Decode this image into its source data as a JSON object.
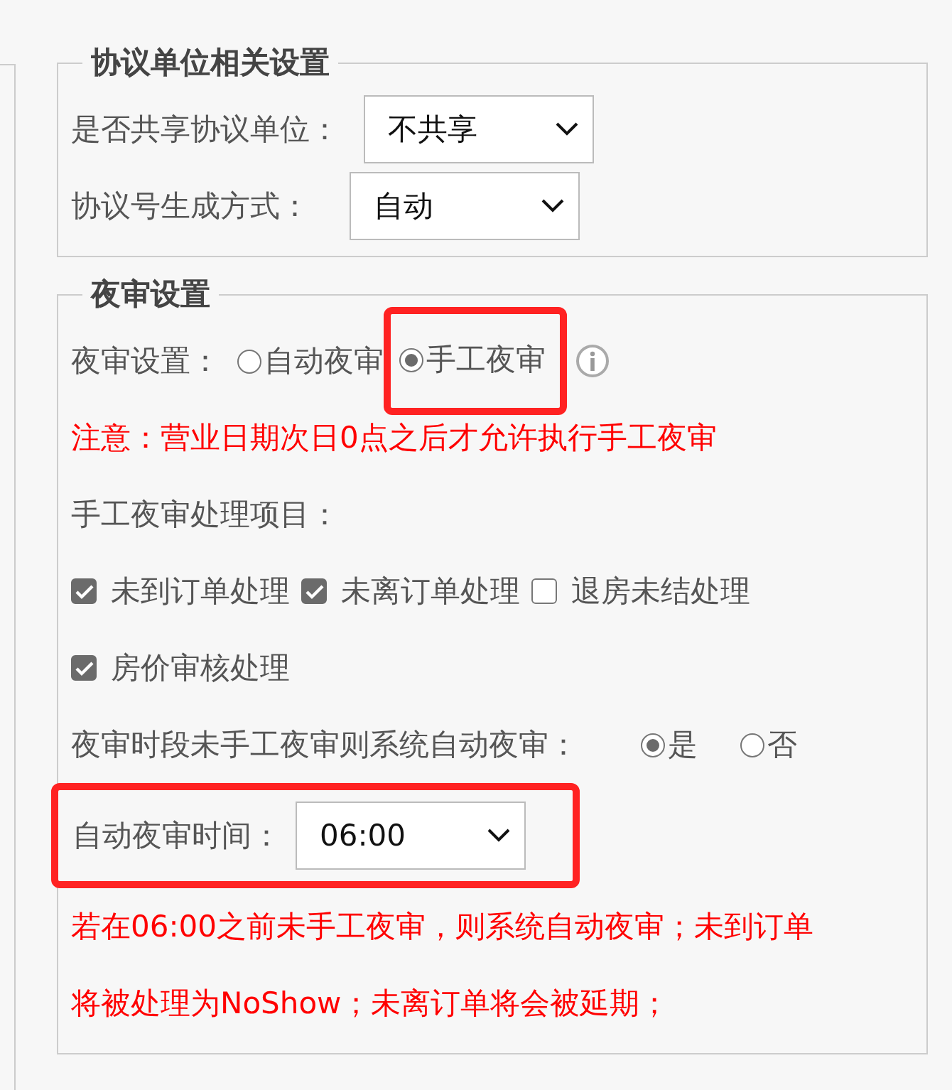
{
  "agreement_settings": {
    "legend": "协议单位相关设置",
    "fields": [
      {
        "label": "是否共享协议单位：",
        "value": "不共享"
      },
      {
        "label": "协议号生成方式：",
        "value": "自动"
      }
    ]
  },
  "night_audit": {
    "legend": "夜审设置",
    "mode": {
      "label": "夜审设置：",
      "options": [
        {
          "label": "自动夜审",
          "selected": false,
          "highlighted": false
        },
        {
          "label": "手工夜审",
          "selected": true,
          "highlighted": true
        }
      ]
    },
    "warning": "注意：营业日期次日0点之后才允许执行手工夜审",
    "items_label": "手工夜审处理项目：",
    "items": [
      {
        "label": "未到订单处理",
        "checked": true
      },
      {
        "label": "未离订单处理",
        "checked": true
      },
      {
        "label": "退房未结处理",
        "checked": false
      },
      {
        "label": "房价审核处理",
        "checked": true
      }
    ],
    "auto_question": {
      "label": "夜审时段未手工夜审则系统自动夜审：",
      "options": [
        {
          "label": "是",
          "selected": true
        },
        {
          "label": "否",
          "selected": false
        }
      ]
    },
    "auto_time": {
      "label": "自动夜审时间：",
      "value": "06:00",
      "highlighted": true
    },
    "note": [
      "若在06:00之前未手工夜审，则系统自动夜审；未到订单",
      "将被处理为NoShow；未离订单将会被延期；"
    ]
  }
}
